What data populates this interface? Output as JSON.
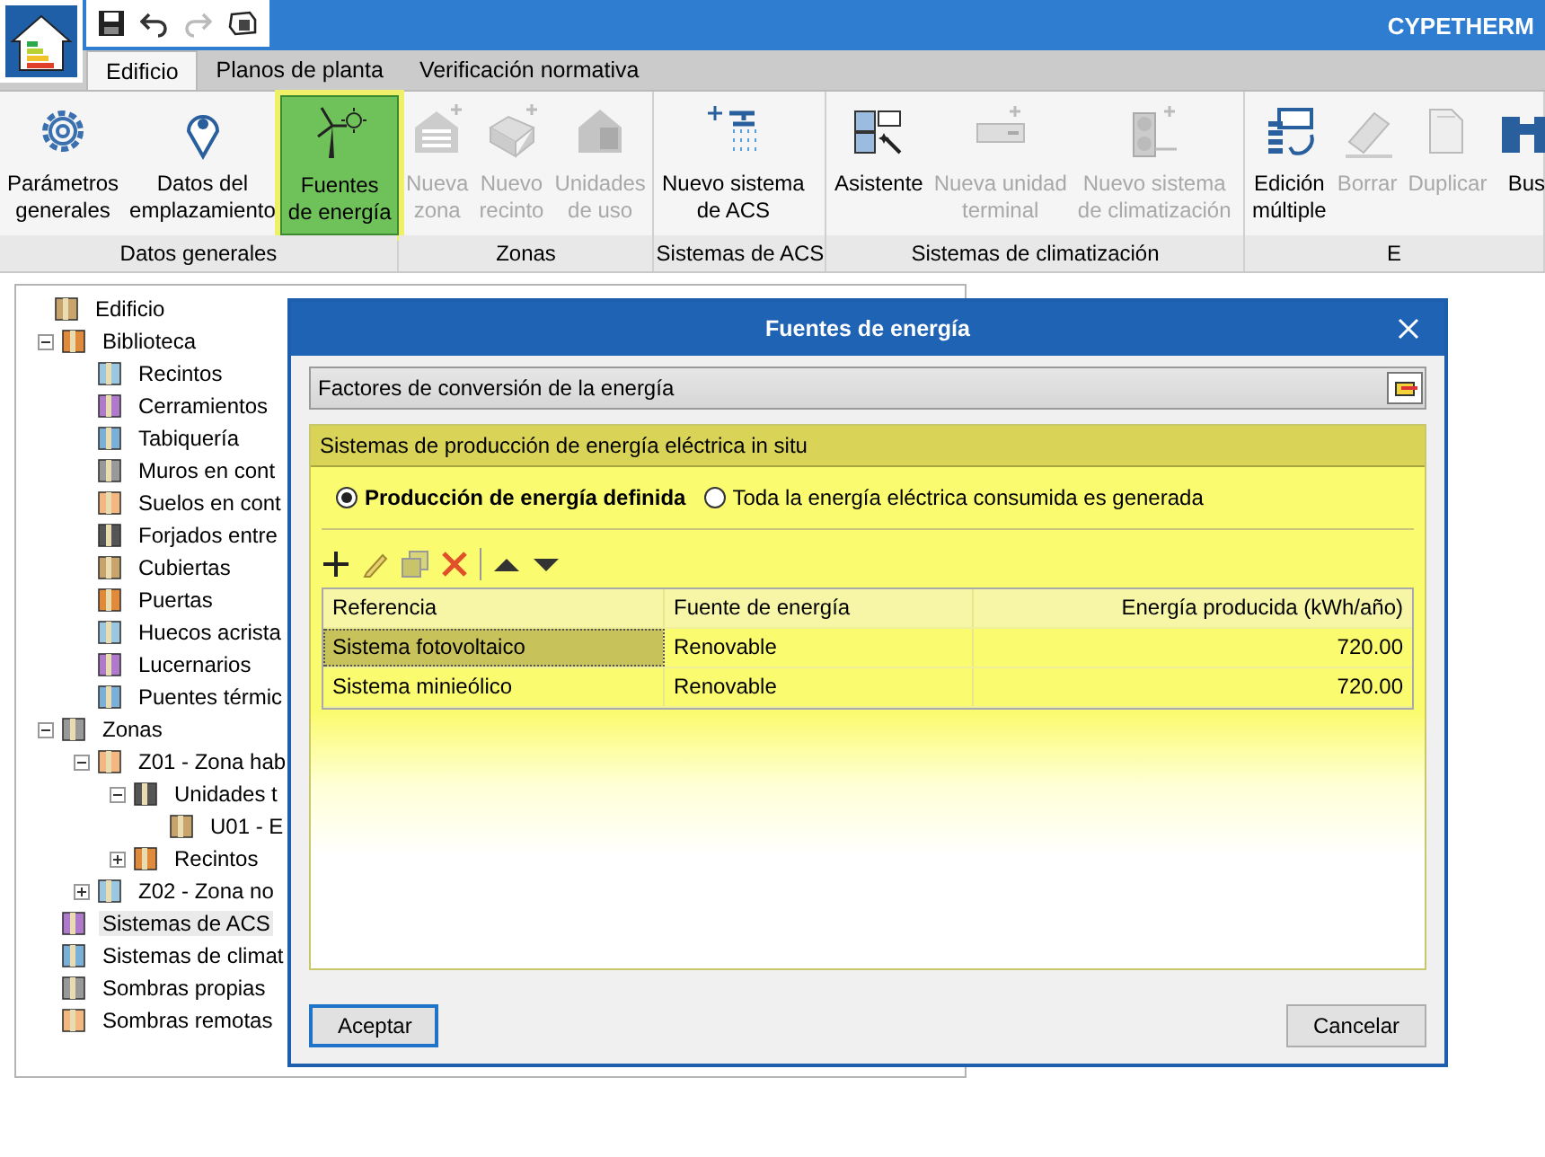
{
  "window": {
    "title": "CYPETHERM"
  },
  "tabs": [
    {
      "label": "Edificio",
      "selected": true
    },
    {
      "label": "Planos de planta",
      "selected": false
    },
    {
      "label": "Verificación normativa",
      "selected": false
    }
  ],
  "ribbon": {
    "groups": [
      {
        "label": "Datos generales",
        "buttons": [
          {
            "label": "Parámetros generales",
            "disabled": false,
            "highlighted": false
          },
          {
            "label": "Datos del emplazamiento",
            "disabled": false,
            "highlighted": false
          },
          {
            "label": "Fuentes de energía",
            "disabled": false,
            "highlighted": true
          }
        ]
      },
      {
        "label": "Zonas",
        "buttons": [
          {
            "label": "Nueva zona",
            "disabled": true,
            "highlighted": false
          },
          {
            "label": "Nuevo recinto",
            "disabled": true,
            "highlighted": false
          },
          {
            "label": "Unidades de uso",
            "disabled": true,
            "highlighted": false
          }
        ]
      },
      {
        "label": "Sistemas de ACS",
        "buttons": [
          {
            "label": "Nuevo sistema de ACS",
            "disabled": false,
            "highlighted": false
          }
        ]
      },
      {
        "label": "Sistemas de climatización",
        "buttons": [
          {
            "label": "Asistente",
            "disabled": false,
            "highlighted": false
          },
          {
            "label": "Nueva unidad terminal",
            "disabled": true,
            "highlighted": false
          },
          {
            "label": "Nuevo sistema de climatización",
            "disabled": true,
            "highlighted": false
          }
        ]
      },
      {
        "label": "E",
        "buttons": [
          {
            "label": "Edición múltiple",
            "disabled": false,
            "highlighted": false
          },
          {
            "label": "Borrar",
            "disabled": true,
            "highlighted": false
          },
          {
            "label": "Duplicar",
            "disabled": true,
            "highlighted": false
          },
          {
            "label": "Bus",
            "disabled": false,
            "highlighted": false
          }
        ]
      }
    ]
  },
  "tree": [
    {
      "label": "Edificio",
      "children": [
        {
          "label": "Biblioteca",
          "expanded": true,
          "children": [
            {
              "label": "Recintos"
            },
            {
              "label": "Cerramientos"
            },
            {
              "label": "Tabiquería"
            },
            {
              "label": "Muros en cont"
            },
            {
              "label": "Suelos en cont"
            },
            {
              "label": "Forjados entre"
            },
            {
              "label": "Cubiertas"
            },
            {
              "label": "Puertas"
            },
            {
              "label": "Huecos acrista"
            },
            {
              "label": "Lucernarios"
            },
            {
              "label": "Puentes térmic"
            }
          ]
        },
        {
          "label": "Zonas",
          "expanded": true,
          "children": [
            {
              "label": "Z01 - Zona hab",
              "expanded": true,
              "children": [
                {
                  "label": "Unidades t",
                  "expanded": true,
                  "children": [
                    {
                      "label": "U01 - E"
                    }
                  ]
                },
                {
                  "label": "Recintos",
                  "expanded": false
                }
              ]
            },
            {
              "label": "Z02 - Zona no",
              "expanded": false
            }
          ]
        },
        {
          "label": "Sistemas de ACS",
          "selected": true
        },
        {
          "label": "Sistemas de climat"
        },
        {
          "label": "Sombras propias"
        },
        {
          "label": "Sombras remotas"
        }
      ]
    }
  ],
  "dialog": {
    "title": "Fuentes de energía",
    "conversion_row": "Factores de conversión de la energía",
    "section": {
      "title": "Sistemas de producción de energía eléctrica in situ",
      "options": [
        {
          "label": "Producción de energía definida",
          "selected": true
        },
        {
          "label": "Toda la energía eléctrica consumida es generada",
          "selected": false
        }
      ],
      "table": {
        "columns": [
          "Referencia",
          "Fuente de energía",
          "Energía producida (kWh/año)"
        ],
        "rows": [
          {
            "cells": [
              "Sistema fotovoltaico",
              "Renovable",
              "720.00"
            ],
            "selected": true
          },
          {
            "cells": [
              "Sistema minieólico",
              "Renovable",
              "720.00"
            ],
            "selected": false
          }
        ]
      }
    },
    "buttons": [
      {
        "label": "Aceptar",
        "default": true
      },
      {
        "label": "Cancelar",
        "default": false
      }
    ]
  }
}
